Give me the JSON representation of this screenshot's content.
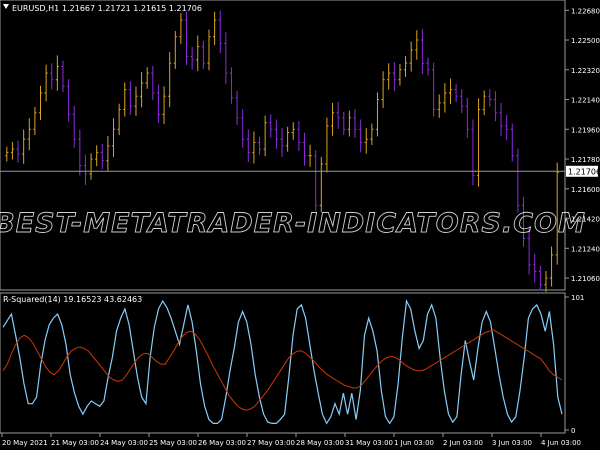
{
  "chart_data": [
    {
      "type": "candlestick",
      "symbol_header": "EURUSD,H1",
      "ohlc_header": "1.21667 1.21721 1.21615 1.21706",
      "last_price_label": "1.21706",
      "last_price": 1.21706,
      "ylim": [
        1.21,
        1.2273
      ],
      "y_ticks": [
        "1.22680",
        "1.22500",
        "1.22320",
        "1.22140",
        "1.21960",
        "1.21780",
        "1.21600",
        "1.21420",
        "1.21240",
        "1.21060"
      ],
      "y_tick_values": [
        1.2268,
        1.225,
        1.2232,
        1.2214,
        1.2196,
        1.2178,
        1.216,
        1.2142,
        1.2124,
        1.2106
      ],
      "watermark": "BEST-METATRADER-INDICATORS.COM",
      "closes": [
        1.2182,
        1.2184,
        1.2181,
        1.219,
        1.2196,
        1.2206,
        1.2218,
        1.223,
        1.2226,
        1.2234,
        1.2222,
        1.2205,
        1.219,
        1.2174,
        1.2169,
        1.2178,
        1.2182,
        1.2177,
        1.2186,
        1.2196,
        1.2208,
        1.222,
        1.221,
        1.2216,
        1.2224,
        1.223,
        1.2218,
        1.2205,
        1.2216,
        1.2236,
        1.2252,
        1.2262,
        1.224,
        1.2238,
        1.2246,
        1.2236,
        1.2252,
        1.2262,
        1.2248,
        1.223,
        1.2215,
        1.2203,
        1.219,
        1.2182,
        1.2188,
        1.2184,
        1.22,
        1.2196,
        1.219,
        1.2186,
        1.2194,
        1.2196,
        1.2188,
        1.218,
        1.218,
        1.215,
        1.2175,
        1.2198,
        1.2206,
        1.2203,
        1.2196,
        1.2203,
        1.2196,
        1.2188,
        1.219,
        1.2196,
        1.2214,
        1.2226,
        1.223,
        1.2226,
        1.2232,
        1.2236,
        1.2244,
        1.225,
        1.2236,
        1.2232,
        1.2208,
        1.2212,
        1.2218,
        1.222,
        1.2216,
        1.221,
        1.2196,
        1.2168,
        1.2208,
        1.2216,
        1.2214,
        1.2206,
        1.2198,
        1.2196,
        1.218,
        1.215,
        1.213,
        1.2114,
        1.211,
        1.2102,
        1.2106,
        1.212,
        1.217
      ],
      "line_color": "#DAA520",
      "down_color": "#8B2BE2"
    },
    {
      "type": "line",
      "header": "R-Squared(14) 19.16523 43.62463",
      "ylim": [
        0,
        101
      ],
      "y_ticks": [
        "101",
        "0"
      ],
      "y_tick_values": [
        101,
        0
      ],
      "x_ticks": [
        "20 May 2021",
        "21 May 03:00",
        "24 May 03:00",
        "25 May 03:00",
        "26 May 03:00",
        "27 May 03:00",
        "28 May 03:00",
        "31 May 03:00",
        "1 Jun 03:00",
        "2 Jun 03:00",
        "3 Jun 03:00",
        "4 Jun 03:00"
      ],
      "series": [
        {
          "color": "#87CEFA",
          "values": [
            78,
            83,
            88,
            72,
            55,
            35,
            20,
            20,
            25,
            50,
            68,
            80,
            85,
            88,
            80,
            65,
            42,
            28,
            18,
            12,
            18,
            22,
            20,
            18,
            22,
            40,
            55,
            75,
            85,
            92,
            80,
            60,
            40,
            25,
            20,
            55,
            78,
            92,
            98,
            93,
            85,
            75,
            65,
            80,
            95,
            82,
            60,
            35,
            18,
            8,
            5,
            5,
            8,
            25,
            45,
            62,
            82,
            90,
            82,
            65,
            42,
            25,
            12,
            6,
            5,
            5,
            8,
            12,
            40,
            72,
            92,
            95,
            85,
            65,
            45,
            28,
            12,
            5,
            10,
            20,
            12,
            28,
            12,
            28,
            8,
            30,
            72,
            85,
            75,
            60,
            30,
            10,
            5,
            10,
            35,
            70,
            98,
            92,
            75,
            62,
            68,
            88,
            95,
            85,
            55,
            30,
            12,
            6,
            10,
            42,
            68,
            52,
            38,
            62,
            82,
            90,
            82,
            62,
            42,
            25,
            12,
            6,
            10,
            30,
            55,
            85,
            92,
            95,
            88,
            75,
            90,
            65,
            25,
            12
          ]
        },
        {
          "color": "#CD3700",
          "values": [
            45,
            50,
            58,
            65,
            70,
            72,
            70,
            66,
            60,
            54,
            48,
            44,
            42,
            45,
            50,
            56,
            60,
            62,
            63,
            62,
            60,
            56,
            52,
            48,
            44,
            40,
            38,
            37,
            38,
            42,
            47,
            52,
            56,
            58,
            58,
            55,
            52,
            50,
            50,
            55,
            60,
            66,
            71,
            74,
            75,
            73,
            69,
            63,
            57,
            50,
            44,
            38,
            32,
            26,
            22,
            18,
            16,
            15,
            16,
            18,
            22,
            26,
            30,
            35,
            40,
            45,
            50,
            55,
            58,
            60,
            60,
            58,
            55,
            52,
            48,
            45,
            42,
            40,
            38,
            36,
            34,
            33,
            32,
            32,
            34,
            38,
            42,
            46,
            50,
            53,
            55,
            56,
            55,
            53,
            50,
            48,
            46,
            45,
            45,
            46,
            48,
            50,
            52,
            54,
            56,
            58,
            60,
            62,
            64,
            66,
            68,
            70,
            72,
            74,
            75,
            76,
            74,
            72,
            70,
            68,
            66,
            64,
            62,
            60,
            58,
            56,
            54,
            50,
            45,
            42,
            40,
            38
          ]
        }
      ]
    }
  ]
}
